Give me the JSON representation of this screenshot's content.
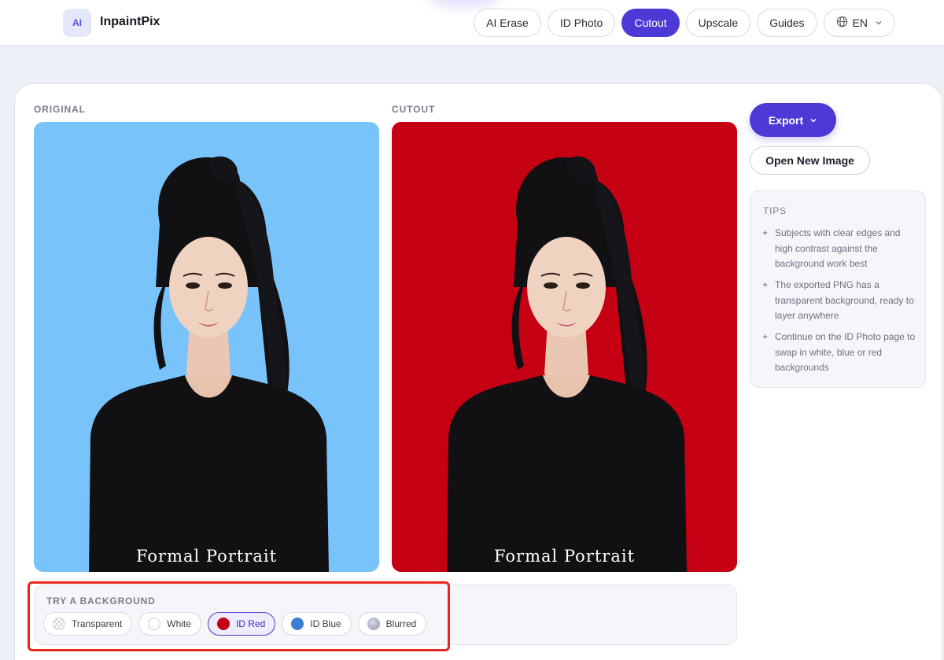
{
  "header": {
    "logo_badge": "AI",
    "brand": "InpaintPix",
    "nav": [
      {
        "label": "AI Erase",
        "active": false
      },
      {
        "label": "ID Photo",
        "active": false
      },
      {
        "label": "Cutout",
        "active": true
      },
      {
        "label": "Upscale",
        "active": false
      },
      {
        "label": "Guides",
        "active": false
      }
    ],
    "language": {
      "label": "EN",
      "icon": "globe-icon"
    }
  },
  "panels": {
    "original": {
      "label": "ORIGINAL",
      "caption": "Formal Portrait",
      "background": "#79c3fb"
    },
    "cutout": {
      "label": "CUTOUT",
      "caption": "Formal Portrait",
      "background": "#c40012"
    }
  },
  "actions": {
    "export_label": "Export",
    "open_label": "Open New Image"
  },
  "tips": {
    "title": "TIPS",
    "items": [
      "Subjects with clear edges and high contrast against the background work best",
      "The exported PNG has a transparent background, ready to layer anywhere",
      "Continue on the ID Photo page to swap in white, blue or red backgrounds"
    ]
  },
  "backgrounds": {
    "label": "TRY A BACKGROUND",
    "options": [
      {
        "label": "Transparent",
        "active": false
      },
      {
        "label": "White",
        "active": false
      },
      {
        "label": "ID Red",
        "active": true
      },
      {
        "label": "ID Blue",
        "active": false
      },
      {
        "label": "Blurred",
        "active": false
      }
    ]
  },
  "colors": {
    "accent": "#4d3ad6",
    "id_red": "#c40012",
    "id_blue": "#3a7fd6",
    "sky_blue": "#79c3fb",
    "highlight": "#e8261a"
  }
}
